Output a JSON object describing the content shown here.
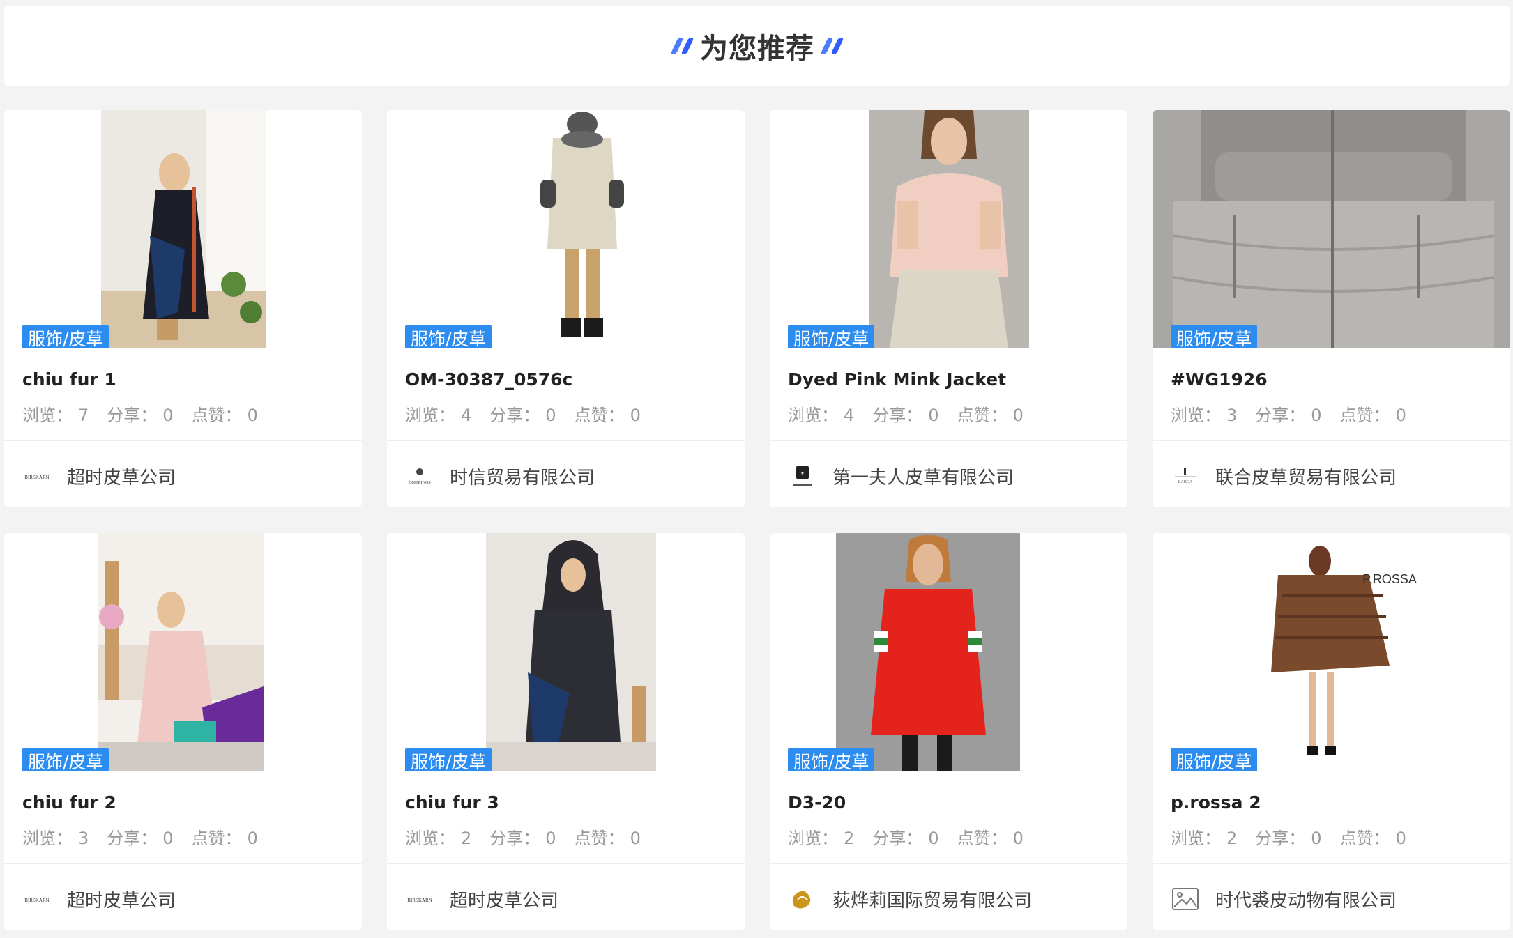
{
  "header": {
    "title": "为您推荐"
  },
  "stat_labels": {
    "views": "浏览：",
    "shares": "分享：",
    "likes": "点赞："
  },
  "cards": [
    {
      "tag": "服饰/皮草",
      "title": "chiu fur 1",
      "views": "7",
      "shares": "0",
      "likes": "0",
      "company": "超时皮草公司",
      "logo_text": "BIRSKARN"
    },
    {
      "tag": "服饰/皮草",
      "title": "OM-30387_0576c",
      "views": "4",
      "shares": "0",
      "likes": "0",
      "company": "时信贸易有限公司",
      "logo_text": "OMERINOS"
    },
    {
      "tag": "服饰/皮草",
      "title": "Dyed Pink Mink Jacket",
      "views": "4",
      "shares": "0",
      "likes": "0",
      "company": "第一夫人皮草有限公司",
      "logo_text": ""
    },
    {
      "tag": "服饰/皮草",
      "title": "#WG1926",
      "views": "3",
      "shares": "0",
      "likes": "0",
      "company": "联合皮草贸易有限公司",
      "logo_text": "LARCA"
    },
    {
      "tag": "服饰/皮草",
      "title": "chiu fur 2",
      "views": "3",
      "shares": "0",
      "likes": "0",
      "company": "超时皮草公司",
      "logo_text": "BIRSKARN"
    },
    {
      "tag": "服饰/皮草",
      "title": "chiu fur 3",
      "views": "2",
      "shares": "0",
      "likes": "0",
      "company": "超时皮草公司",
      "logo_text": "BIRSKARN"
    },
    {
      "tag": "服饰/皮草",
      "title": "D3-20",
      "views": "2",
      "shares": "0",
      "likes": "0",
      "company": "荻烨莉国际贸易有限公司",
      "logo_text": ""
    },
    {
      "tag": "服饰/皮草",
      "title": "p.rossa 2",
      "views": "2",
      "shares": "0",
      "likes": "0",
      "company": "时代裘皮动物有限公司",
      "logo_text": "",
      "photo_text": "P.ROSSA"
    }
  ],
  "colors": {
    "tag_bg": "#2c8cf0",
    "accent": "#2f5bff"
  }
}
